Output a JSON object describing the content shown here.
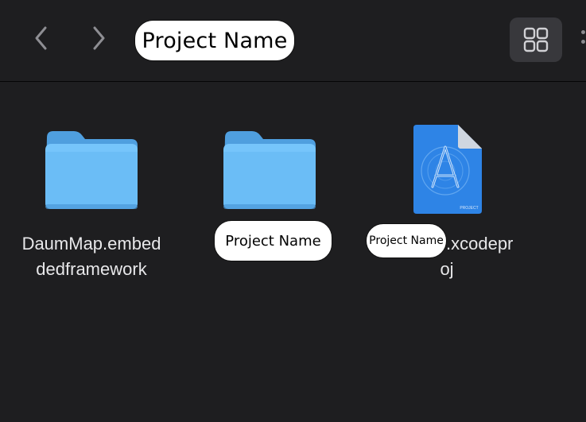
{
  "toolbar": {
    "title": "Project Name",
    "back_icon": "chevron-left-icon",
    "forward_icon": "chevron-right-icon",
    "view_icon": "grid-view-icon",
    "more_icon": "more-vertical-icon"
  },
  "files": [
    {
      "kind": "folder",
      "name_line1": "DaumMap.embed",
      "name_line2": "dedframework"
    },
    {
      "kind": "folder",
      "name": "Project Name"
    },
    {
      "kind": "xcodeproj",
      "name_pill": "Project Name",
      "name_suffix_line1": ".xcodepr",
      "name_suffix_line2": "oj",
      "badge": "PROJECT"
    }
  ],
  "colors": {
    "background": "#1e1e20",
    "folder": "#5fb4f0",
    "folder_tab": "#52a4e3",
    "xcode_blue": "#2c7fe0",
    "label_text": "#e8e8ea"
  }
}
